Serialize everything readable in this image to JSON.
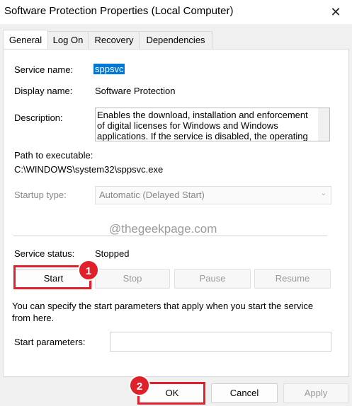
{
  "window": {
    "title": "Software Protection Properties (Local Computer)",
    "close_glyph": "✕"
  },
  "tabs": [
    {
      "label": "General",
      "active": true
    },
    {
      "label": "Log On"
    },
    {
      "label": "Recovery"
    },
    {
      "label": "Dependencies"
    }
  ],
  "general": {
    "service_name_label": "Service name:",
    "service_name_value": "sppsvc",
    "display_name_label": "Display name:",
    "display_name_value": "Software Protection",
    "description_label": "Description:",
    "description_lines": [
      "Enables the download, installation and enforcement",
      "of digital licenses for Windows and Windows",
      "applications. If the service is disabled, the operating"
    ],
    "path_label": "Path to executable:",
    "path_value": "C:\\WINDOWS\\system32\\sppsvc.exe",
    "startup_type_label": "Startup type:",
    "startup_type_value": "Automatic (Delayed Start)",
    "watermark": "@thegeekpage.com",
    "service_status_label": "Service status:",
    "service_status_value": "Stopped",
    "buttons": {
      "start": "Start",
      "stop": "Stop",
      "pause": "Pause",
      "resume": "Resume"
    },
    "info_text": "You can specify the start parameters that apply when you start the service from here.",
    "start_params_label": "Start parameters:",
    "start_params_value": ""
  },
  "footer": {
    "ok": "OK",
    "cancel": "Cancel",
    "apply": "Apply"
  },
  "annotations": {
    "badge1": "1",
    "badge2": "2",
    "color": "#e0202b"
  }
}
